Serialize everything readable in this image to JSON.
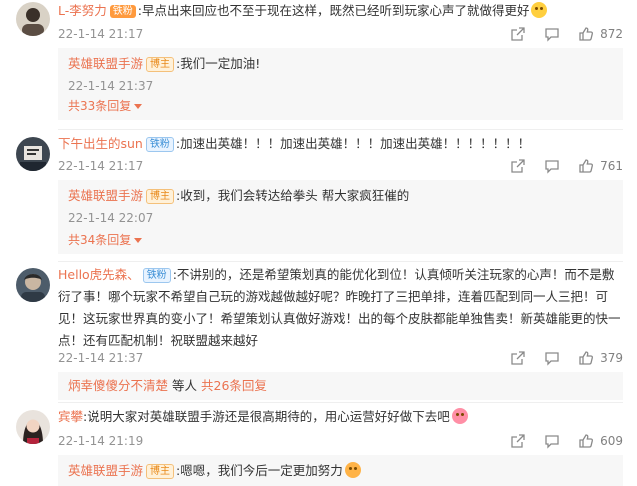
{
  "comments": [
    {
      "user": "L-李努力",
      "badge": "铁粉",
      "text": ":早点出来回应也不至于现在这样，既然已经听到玩家心声了就做得更好",
      "time": "22-1-14 21:17",
      "likes": "872",
      "reply": {
        "user": "英雄联盟手游",
        "badge": "博主",
        "text": ":我们一定加油!",
        "time": "22-1-14 21:37"
      },
      "more": "共33条回复"
    },
    {
      "user": "下午出生的sun",
      "badge": "铁粉",
      "text": ":加速出英雄！！！加速出英雄！！！加速出英雄！！！！！！！",
      "time": "22-1-14 21:17",
      "likes": "761",
      "reply": {
        "user": "英雄联盟手游",
        "badge": "博主",
        "text": ":收到，我们会转达给拳头 帮大家疯狂催的",
        "time": "22-1-14 22:07"
      },
      "more": "共34条回复"
    },
    {
      "user": "Hello虎先森、",
      "badge": "铁粉",
      "text": ":不讲别的，还是希望策划真的能优化到位！认真倾听关注玩家的心声！而不是敷衍了事！哪个玩家不希望自己玩的游戏越做越好呢？昨晚打了三把单排，连着匹配到同一人三把！可见！这玩家世界真的变小了！希望策划认真做好游戏！出的每个皮肤都能单独售卖！新英雄能更的快一点！还有匹配机制！祝联盟越来越好",
      "time": "22-1-14 21:37",
      "likes": "379",
      "reply_summary": {
        "user": "炳幸傻傻分不清楚",
        "middle": "等人",
        "more": "共26条回复"
      }
    },
    {
      "user": "宾攀",
      "text": ":说明大家对英雄联盟手游还是很高期待的，用心运营好好做下去吧",
      "time": "22-1-14 21:19",
      "likes": "609",
      "reply": {
        "user": "英雄联盟手游",
        "badge": "博主",
        "text": ":嗯嗯，我们今后一定更加努力"
      }
    }
  ],
  "icons": {
    "share": "share-icon",
    "comment": "comment-icon",
    "like": "thumb-up-icon"
  }
}
